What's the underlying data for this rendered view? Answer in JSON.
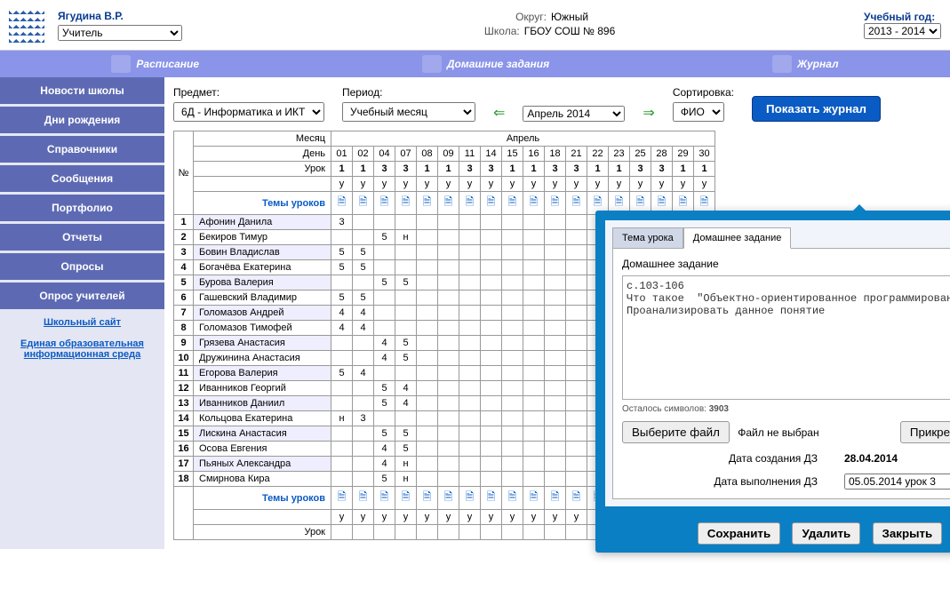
{
  "header": {
    "user_name": "Ягудина В.Р.",
    "role": "Учитель",
    "district_label": "Округ:",
    "district": "Южный",
    "school_label": "Школа:",
    "school": "ГБОУ СОШ № 896",
    "year_label": "Учебный год:",
    "year": "2013 - 2014"
  },
  "menu": {
    "schedule": "Расписание",
    "homework": "Домашние задания",
    "journal": "Журнал"
  },
  "sidebar": {
    "items": [
      "Новости школы",
      "Дни рождения",
      "Справочники",
      "Сообщения",
      "Портфолио",
      "Отчеты",
      "Опросы",
      "Опрос учителей"
    ],
    "link1": "Школьный сайт",
    "link2": "Единая образовательная информационная среда"
  },
  "filters": {
    "subject_label": "Предмет:",
    "subject": "6Д - Информатика и ИКТ",
    "period_label": "Период:",
    "period": "Учебный месяц",
    "month": "Апрель 2014",
    "sort_label": "Сортировка:",
    "sort": "ФИО",
    "btn": "Показать журнал"
  },
  "grid": {
    "numsign": "№",
    "month_label": "Месяц",
    "month": "Апрель",
    "day_label": "День",
    "days": [
      "01",
      "02",
      "04",
      "07",
      "08",
      "09",
      "11",
      "14",
      "15",
      "16",
      "18",
      "21",
      "22",
      "23",
      "25",
      "28",
      "29",
      "30"
    ],
    "lesson_label": "Урок",
    "lessons": [
      "1",
      "1",
      "3",
      "3",
      "1",
      "1",
      "3",
      "3",
      "1",
      "1",
      "3",
      "3",
      "1",
      "1",
      "3",
      "3",
      "1",
      "1"
    ],
    "ulabel": "у",
    "themes": "Темы уроков",
    "students": [
      {
        "n": "1",
        "name": "Афонин Данила",
        "g": [
          "3",
          "",
          "",
          "",
          "",
          "",
          "",
          "",
          "",
          "",
          "",
          "",
          "",
          "",
          "",
          "",
          "",
          ""
        ]
      },
      {
        "n": "2",
        "name": "Бекиров Тимур",
        "g": [
          "",
          "",
          "5",
          "н",
          "",
          "",
          "",
          "",
          "",
          "",
          "",
          "",
          "",
          "",
          "",
          "",
          "",
          ""
        ]
      },
      {
        "n": "3",
        "name": "Бовин Владислав",
        "g": [
          "5",
          "5",
          "",
          "",
          "",
          "",
          "",
          "",
          "",
          "",
          "",
          "",
          "",
          "",
          "",
          "",
          "",
          ""
        ]
      },
      {
        "n": "4",
        "name": "Богачёва Екатерина",
        "g": [
          "5",
          "5",
          "",
          "",
          "",
          "",
          "",
          "",
          "",
          "",
          "",
          "",
          "",
          "",
          "",
          "",
          "",
          ""
        ]
      },
      {
        "n": "5",
        "name": "Бурова Валерия",
        "g": [
          "",
          "",
          "5",
          "5",
          "",
          "",
          "",
          "",
          "",
          "",
          "",
          "",
          "",
          "",
          "",
          "",
          "",
          ""
        ]
      },
      {
        "n": "6",
        "name": "Гашевский Владимир",
        "g": [
          "5",
          "5",
          "",
          "",
          "",
          "",
          "",
          "",
          "",
          "",
          "",
          "",
          "",
          "",
          "",
          "",
          "",
          ""
        ]
      },
      {
        "n": "7",
        "name": "Голомазов Андрей",
        "g": [
          "4",
          "4",
          "",
          "",
          "",
          "",
          "",
          "",
          "",
          "",
          "",
          "",
          "",
          "",
          "",
          "",
          "",
          ""
        ]
      },
      {
        "n": "8",
        "name": "Голомазов Тимофей",
        "g": [
          "4",
          "4",
          "",
          "",
          "",
          "",
          "",
          "",
          "",
          "",
          "",
          "",
          "",
          "",
          "",
          "",
          "",
          ""
        ]
      },
      {
        "n": "9",
        "name": "Грязева Анастасия",
        "g": [
          "",
          "",
          "4",
          "5",
          "",
          "",
          "",
          "",
          "",
          "",
          "",
          "",
          "",
          "",
          "",
          "",
          "",
          ""
        ]
      },
      {
        "n": "10",
        "name": "Дружинина Анастасия",
        "g": [
          "",
          "",
          "4",
          "5",
          "",
          "",
          "",
          "",
          "",
          "",
          "",
          "",
          "",
          "",
          "",
          "",
          "",
          ""
        ]
      },
      {
        "n": "11",
        "name": "Егорова Валерия",
        "g": [
          "5",
          "4",
          "",
          "",
          "",
          "",
          "",
          "",
          "",
          "",
          "",
          "",
          "",
          "",
          "",
          "",
          "",
          ""
        ]
      },
      {
        "n": "12",
        "name": "Иванников Георгий",
        "g": [
          "",
          "",
          "5",
          "4",
          "",
          "",
          "",
          "",
          "",
          "",
          "",
          "",
          "",
          "",
          "",
          "",
          "",
          ""
        ]
      },
      {
        "n": "13",
        "name": "Иванников Даниил",
        "g": [
          "",
          "",
          "5",
          "4",
          "",
          "",
          "",
          "",
          "",
          "",
          "",
          "",
          "",
          "",
          "",
          "",
          "",
          ""
        ]
      },
      {
        "n": "14",
        "name": "Кольцова Екатерина",
        "g": [
          "н",
          "3",
          "",
          "",
          "",
          "",
          "",
          "",
          "",
          "",
          "",
          "",
          "",
          "",
          "",
          "",
          "",
          ""
        ]
      },
      {
        "n": "15",
        "name": "Лискина Анастасия",
        "g": [
          "",
          "",
          "5",
          "5",
          "",
          "",
          "",
          "",
          "",
          "",
          "",
          "",
          "",
          "",
          "",
          "",
          "",
          ""
        ]
      },
      {
        "n": "16",
        "name": "Осова Евгения",
        "g": [
          "",
          "",
          "4",
          "5",
          "",
          "",
          "",
          "",
          "",
          "",
          "",
          "",
          "",
          "",
          "",
          "",
          "",
          ""
        ]
      },
      {
        "n": "17",
        "name": "Пьяных Александра",
        "g": [
          "",
          "",
          "4",
          "н",
          "",
          "",
          "",
          "",
          "",
          "",
          "",
          "",
          "",
          "",
          "",
          "",
          "",
          ""
        ]
      },
      {
        "n": "18",
        "name": "Смирнова Кира",
        "g": [
          "",
          "",
          "5",
          "н",
          "",
          "",
          "",
          "",
          "",
          "",
          "",
          "",
          "",
          "",
          "",
          "",
          "",
          ""
        ]
      }
    ]
  },
  "popup": {
    "tab1": "Тема урока",
    "tab2": "Домашнее задание",
    "hw_title": "Домашнее задание",
    "hw_text": "с.103-106\nЧто такое  \"Объектно-ориентированное программирование\".\nПроанализировать данное понятие",
    "counter_label": "Осталось символов:",
    "counter": "3903",
    "file_btn": "Выберите файл",
    "file_status": "Файл не выбран",
    "attach_btn": "Прикрепить файл",
    "date_created_label": "Дата создания ДЗ",
    "date_created": "28.04.2014",
    "date_due_label": "Дата выполнения ДЗ",
    "date_due": "05.05.2014 урок 3",
    "save": "Сохранить",
    "delete": "Удалить",
    "close": "Закрыть"
  }
}
